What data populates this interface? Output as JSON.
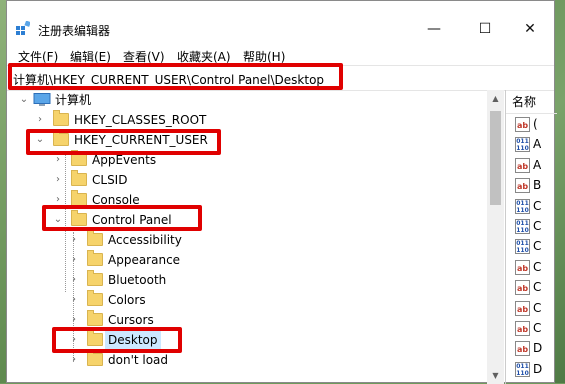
{
  "window": {
    "title": "注册表编辑器",
    "controls": {
      "minimize": "—",
      "maximize": "☐",
      "close": "✕"
    }
  },
  "menu": [
    "文件(F)",
    "编辑(E)",
    "查看(V)",
    "收藏夹(A)",
    "帮助(H)"
  ],
  "address": "计算机\\HKEY_CURRENT_USER\\Control Panel\\Desktop",
  "tree": {
    "root": "计算机",
    "items": [
      {
        "label": "HKEY_CLASSES_ROOT",
        "level": 1,
        "expanded": false
      },
      {
        "label": "HKEY_CURRENT_USER",
        "level": 1,
        "expanded": true
      },
      {
        "label": "AppEvents",
        "level": 2,
        "expanded": false
      },
      {
        "label": "CLSID",
        "level": 2,
        "expanded": false
      },
      {
        "label": "Console",
        "level": 2,
        "expanded": false
      },
      {
        "label": "Control Panel",
        "level": 2,
        "expanded": true
      },
      {
        "label": "Accessibility",
        "level": 3,
        "expanded": false
      },
      {
        "label": "Appearance",
        "level": 3,
        "expanded": false
      },
      {
        "label": "Bluetooth",
        "level": 3,
        "expanded": false
      },
      {
        "label": "Colors",
        "level": 3,
        "expanded": false
      },
      {
        "label": "Cursors",
        "level": 3,
        "expanded": false
      },
      {
        "label": "Desktop",
        "level": 3,
        "expanded": false,
        "selected": true
      },
      {
        "label": "don't load",
        "level": 3,
        "expanded": false
      }
    ]
  },
  "values_pane": {
    "header": "名称",
    "rows": [
      {
        "icon": "ab",
        "text": "("
      },
      {
        "icon": "bin",
        "text": "A"
      },
      {
        "icon": "ab",
        "text": "A"
      },
      {
        "icon": "ab",
        "text": "B"
      },
      {
        "icon": "bin",
        "text": "C"
      },
      {
        "icon": "bin",
        "text": "C"
      },
      {
        "icon": "bin",
        "text": "C"
      },
      {
        "icon": "ab",
        "text": "C"
      },
      {
        "icon": "ab",
        "text": "C"
      },
      {
        "icon": "ab",
        "text": "C"
      },
      {
        "icon": "ab",
        "text": "C"
      },
      {
        "icon": "ab",
        "text": "D"
      },
      {
        "icon": "bin",
        "text": "D"
      }
    ]
  },
  "colors": {
    "highlight": "#e00000",
    "selection": "#cce8ff",
    "folder": "#f6d36b"
  }
}
